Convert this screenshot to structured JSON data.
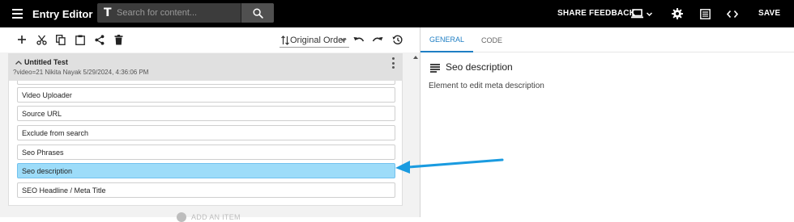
{
  "app": {
    "title": "Entry Editor",
    "search_placeholder": "Search for content...",
    "share_feedback": "SHARE FEEDBACK",
    "save": "SAVE"
  },
  "toolbar": {
    "tools": [
      "add-icon",
      "cut-icon",
      "copy-icon",
      "paste-icon",
      "share-icon",
      "delete-icon"
    ],
    "sort_label": "Original Order",
    "history": [
      "undo-icon",
      "redo-icon",
      "history-icon"
    ]
  },
  "tree": {
    "title": "Untitled Test",
    "meta": "?video=21 Nikita Nayak 5/29/2024, 4:36:06 PM",
    "items": [
      {
        "label": "Video Uploader",
        "selected": false
      },
      {
        "label": "Source URL",
        "selected": false
      },
      {
        "label": "Exclude from search",
        "selected": false
      },
      {
        "label": "Seo Phrases",
        "selected": false
      },
      {
        "label": "Seo description",
        "selected": true
      },
      {
        "label": "SEO Headline / Meta Title",
        "selected": false
      }
    ],
    "add_hint": "ADD AN ITEM"
  },
  "panel": {
    "tabs": [
      {
        "label": "GENERAL",
        "active": true
      },
      {
        "label": "CODE",
        "active": false
      }
    ],
    "title": "Seo description",
    "description": "Element to edit meta description"
  },
  "colors": {
    "topbar": "#000000",
    "accent": "#1f7fc4",
    "selected_item": "#9ddcf9",
    "annotation_arrow": "#1a9be0"
  }
}
